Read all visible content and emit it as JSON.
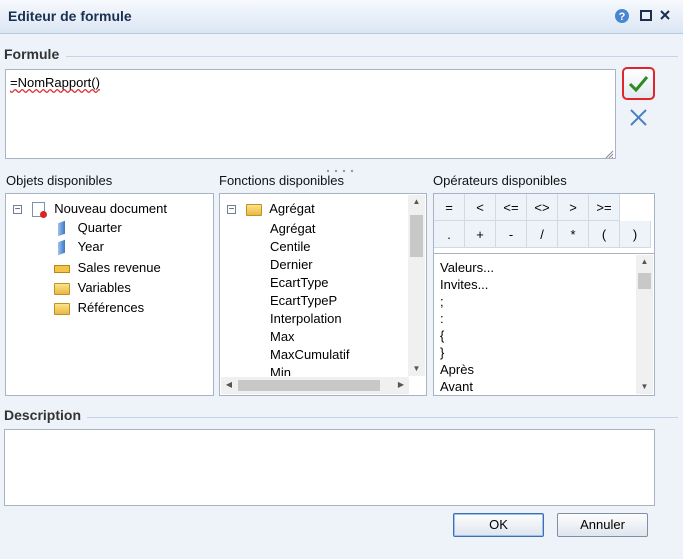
{
  "window": {
    "title": "Editeur de formule"
  },
  "formula": {
    "section_label": "Formule",
    "value": "=NomRapport()"
  },
  "objects": {
    "label": "Objets disponibles",
    "root": "Nouveau document",
    "items": [
      "Quarter",
      "Year",
      "Sales revenue",
      "Variables",
      "Références"
    ]
  },
  "functions": {
    "label": "Fonctions disponibles",
    "category": "Agrégat",
    "items": [
      "Agrégat",
      "Centile",
      "Dernier",
      "EcartType",
      "EcartTypeP",
      "Interpolation",
      "Max",
      "MaxCumulatif",
      "Min"
    ]
  },
  "operators": {
    "label": "Opérateurs disponibles",
    "row1": [
      "=",
      "<",
      "<=",
      "<>",
      ">",
      ">="
    ],
    "row2": [
      ".",
      "+",
      "-",
      "/",
      "*",
      "(",
      ")"
    ],
    "list": [
      "Valeurs...",
      "Invites...",
      ";",
      ":",
      "{",
      "}",
      "Après",
      "Avant"
    ]
  },
  "description": {
    "label": "Description",
    "value": ""
  },
  "buttons": {
    "ok": "OK",
    "cancel": "Annuler"
  },
  "colors": {
    "validate_highlight": "#e0262c",
    "check_green": "#2e8b1f",
    "cancel_blue": "#4a7fc0"
  }
}
